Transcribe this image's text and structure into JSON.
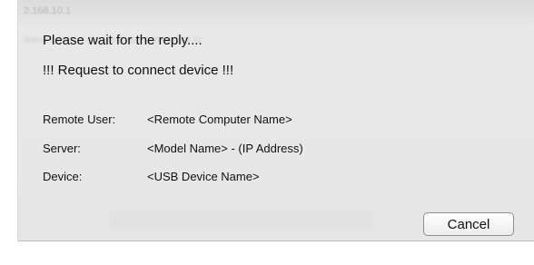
{
  "background": {
    "ghost_line_1": "2.168.10.1",
    "ghost_line_2": "lease select a device to be connected to"
  },
  "dialog": {
    "wait_message": "Please wait for the reply....",
    "request_message": "!!! Request to connect device !!!",
    "rows": [
      {
        "label": "Remote User:",
        "value": "<Remote Computer Name>"
      },
      {
        "label": "Server:",
        "value": "<Model Name> - (IP Address)"
      },
      {
        "label": "Device:",
        "value": "<USB Device Name>"
      }
    ],
    "cancel_label": "Cancel"
  }
}
